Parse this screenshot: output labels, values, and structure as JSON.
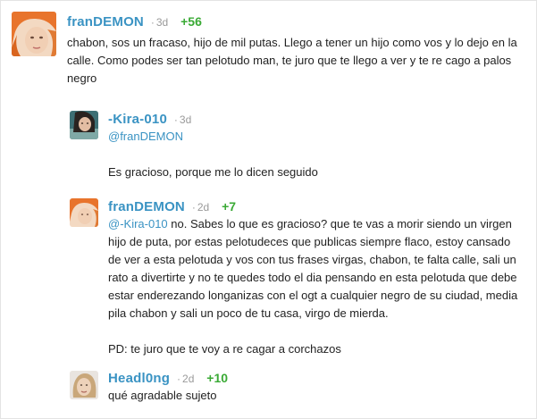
{
  "comments": [
    {
      "user": "franDEMON",
      "time": "3d",
      "score": "+56",
      "text": "chabon, sos un fracaso, hijo de mil putas. Llego a tener un hijo como vos y lo dejo en la calle. Como podes ser tan pelotudo man, te juro que te llego a ver y te re cago a palos negro"
    },
    {
      "user": "-Kira-010",
      "time": "3d",
      "mention": "@franDEMON",
      "text": "Es gracioso, porque me lo dicen seguido"
    },
    {
      "user": "franDEMON",
      "time": "2d",
      "score": "+7",
      "mention": "@-Kira-010",
      "text": " no. Sabes lo que es gracioso? que te vas a morir siendo un virgen hijo de puta, por estas pelotudeces que publicas siempre flaco, estoy cansado de ver a esta pelotuda y vos con tus frases virgas, chabon, te falta calle, sali un rato a divertirte y no te quedes todo el dia pensando en esta pelotuda que debe estar enderezando longanizas con el ogt a cualquier negro de su ciudad, media pila chabon y sali un poco de tu casa, virgo de mierda.",
      "text2": "PD: te juro que te voy a re cagar a corchazos"
    },
    {
      "user": "Headl0ng",
      "time": "2d",
      "score": "+10",
      "text": "qué agradable sujeto"
    }
  ],
  "separator": "·"
}
